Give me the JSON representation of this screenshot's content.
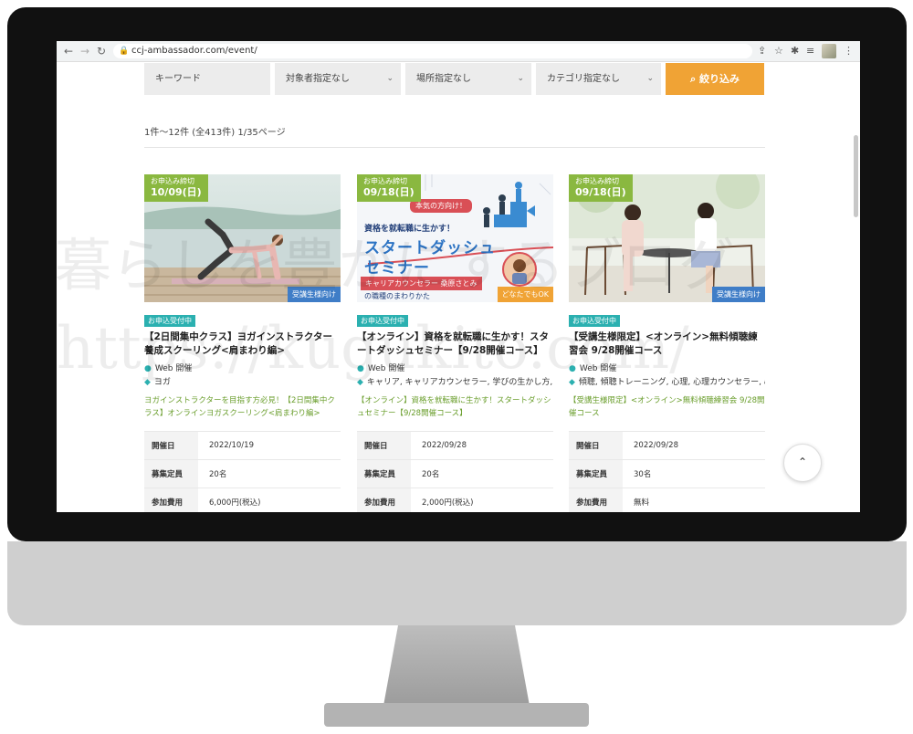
{
  "browser": {
    "url": "ccj-ambassador.com/event/"
  },
  "search": {
    "keyword_placeholder": "キーワード",
    "target_filter": "対象者指定なし",
    "location_filter": "場所指定なし",
    "category_filter": "カテゴリ指定なし",
    "submit_label": "絞り込み"
  },
  "results": {
    "summary": "1件〜12件 (全413件) 1/35ページ"
  },
  "cards": [
    {
      "deadline_label": "お申込み締切",
      "deadline_date": "10/09(日)",
      "target_badge": "受講生様向け",
      "status": "お申込受付中",
      "title": "【2日間集中クラス】ヨガインストラクター養成スクーリング<肩まわり編>",
      "location": "Web 開催",
      "tags": "ヨガ",
      "description": "ヨガインストラクターを目指す方必見！【2日間集中クラス】オンラインヨガスクーリング<肩まわり編>",
      "rows": [
        {
          "key": "開催日",
          "value": "2022/10/19"
        },
        {
          "key": "募集定員",
          "value": "20名"
        },
        {
          "key": "参加費用",
          "value": "6,000円(税込)"
        }
      ]
    },
    {
      "deadline_label": "お申込み締切",
      "deadline_date": "09/18(日)",
      "target_badge": "どなたでもOK",
      "status": "お申込受付中",
      "title": "【オンライン】資格を就転職に生かす！スタートダッシュセミナー【9/28開催コース】",
      "location": "Web 開催",
      "tags": "キャリア, キャリアカウンセラー, 学びの生かし方, 就転職",
      "description": "【オンライン】資格を就転職に生かす！スタートダッシュセミナー【9/28開催コース】",
      "banner": {
        "bubble": "本気の方向け！",
        "line1": "資格を就転職に生かす！",
        "line2": "スタートダッシュ",
        "line3": "セミナー",
        "speaker": "キャリアカウンセラー 桑原さとみ",
        "footer": "の職種のまわりかた"
      },
      "rows": [
        {
          "key": "開催日",
          "value": "2022/09/28"
        },
        {
          "key": "募集定員",
          "value": "20名"
        },
        {
          "key": "参加費用",
          "value": "2,000円(税込)"
        }
      ]
    },
    {
      "deadline_label": "お申込み締切",
      "deadline_date": "09/18(日)",
      "target_badge": "受講生様向け",
      "status": "お申込受付中",
      "title": "【受講生様限定】<オンライン>無料傾聴練習会 9/28開催コース",
      "location": "Web 開催",
      "tags": "傾聴, 傾聴トレーニング, 心理, 心理カウンセラー, 心理学",
      "description": "【受講生様限定】<オンライン>無料傾聴練習会 9/28開催コース",
      "rows": [
        {
          "key": "開催日",
          "value": "2022/09/28"
        },
        {
          "key": "募集定員",
          "value": "30名"
        },
        {
          "key": "参加費用",
          "value": "無料"
        }
      ]
    }
  ],
  "watermark": {
    "line1": "暮らしを豊かにするブログ",
    "line2": "https://kugukito.com/"
  },
  "colors": {
    "accent_orange": "#f0a335",
    "deadline_green": "#8ab840",
    "status_teal": "#2bb0b0",
    "target_blue": "#3f7dc7",
    "desc_green": "#6a9e2c"
  },
  "icons": {
    "back": "arrow-left-icon",
    "forward": "arrow-right-icon",
    "reload": "reload-icon",
    "lock": "lock-icon",
    "search": "search-icon",
    "location": "location-pin-icon",
    "tag": "tag-icon",
    "scroll_top": "chevron-up-icon"
  }
}
